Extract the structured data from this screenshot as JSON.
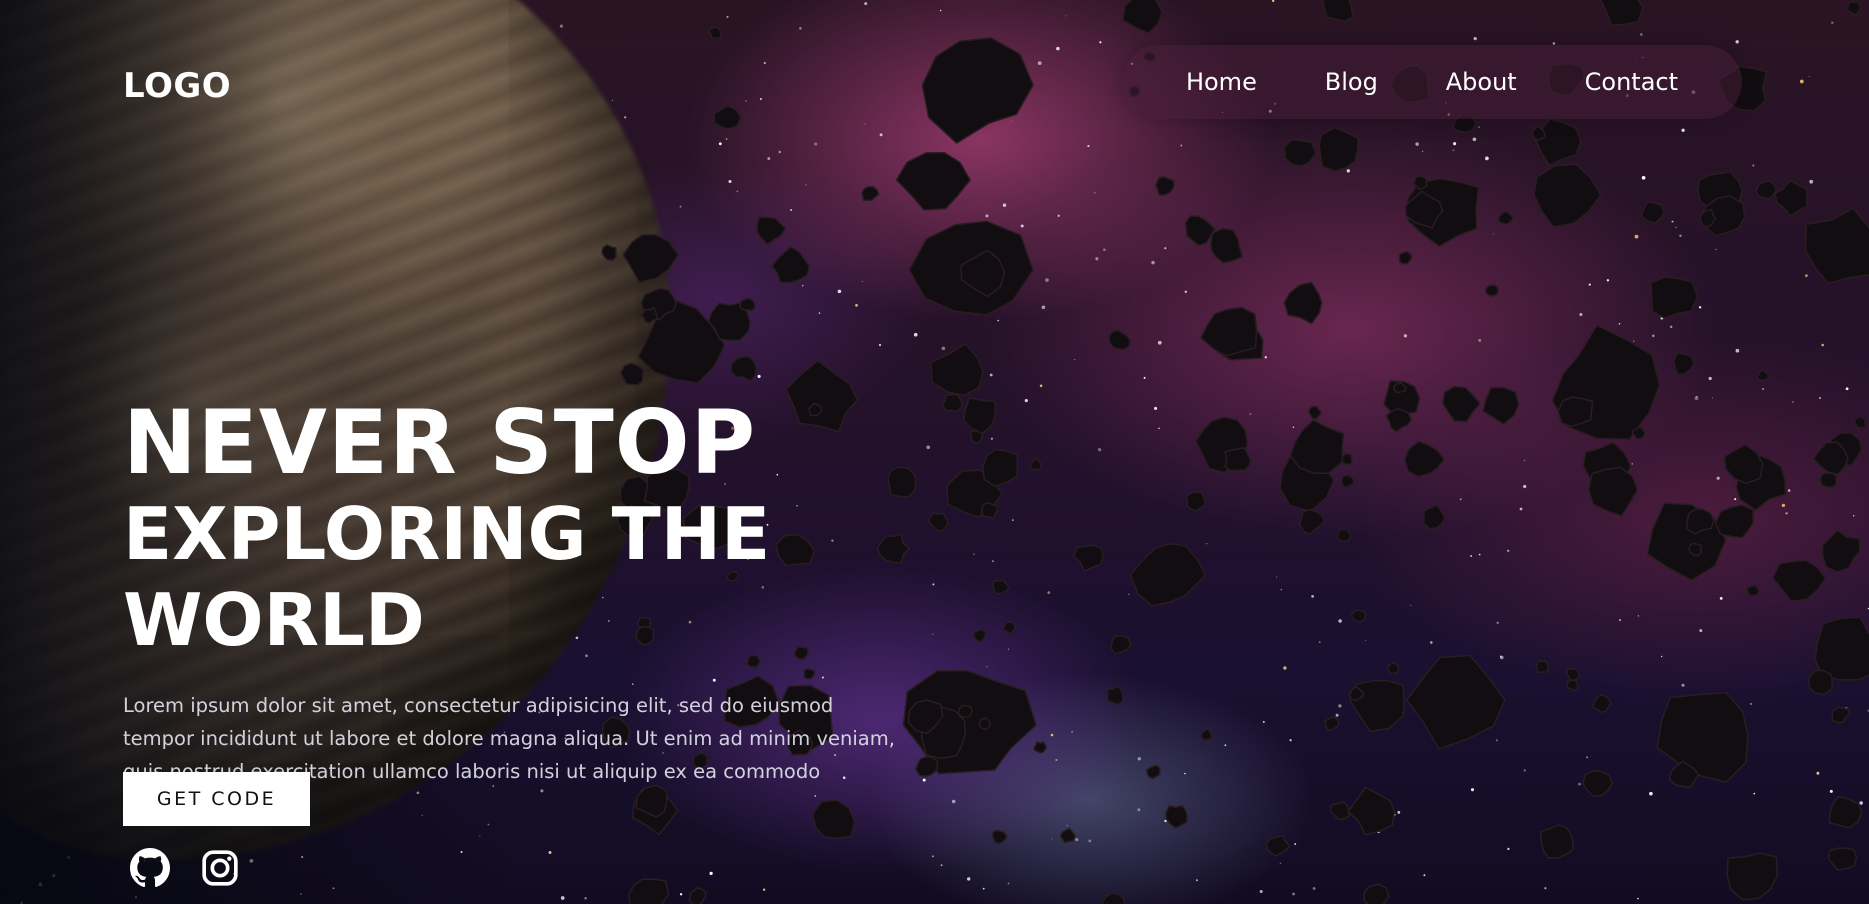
{
  "header": {
    "logo": "LOGO",
    "nav": [
      {
        "label": "Home"
      },
      {
        "label": "Blog"
      },
      {
        "label": "About"
      },
      {
        "label": "Contact"
      }
    ]
  },
  "hero": {
    "title_line1": "NEVER STOP",
    "title_line2": "EXPLORING THE WORLD",
    "description": "Lorem ipsum dolor sit amet, consectetur adipisicing elit, sed do eiusmod tempor incididunt ut labore et dolore magna aliqua. Ut enim ad minim veniam, quis nostrud exercitation ullamco laboris nisi ut aliquip ex ea commodo consequat.",
    "cta_label": "GET CODE"
  },
  "social": [
    {
      "icon": "github-icon"
    },
    {
      "icon": "instagram-icon"
    }
  ],
  "colors": {
    "text": "#ffffff",
    "nav_background": "#461e37",
    "cta_background": "#ffffff",
    "cta_text": "#111111"
  }
}
